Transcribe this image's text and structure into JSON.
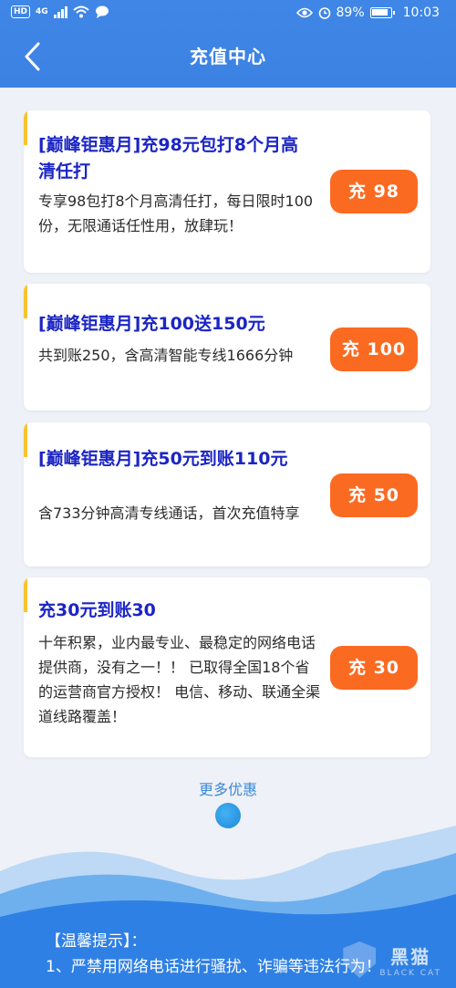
{
  "status_bar": {
    "network": "4G",
    "battery_percent": "89%",
    "time": "10:03"
  },
  "header": {
    "title": "充值中心"
  },
  "offers": [
    {
      "title": "[巅峰钜惠月]充98元包打8个月高清任打",
      "description": "专享98包打8个月高清任打，每日限时100份，无限通话任性用，放肆玩！",
      "button_label": "充 98"
    },
    {
      "title": "[巅峰钜惠月]充100送150元",
      "description": "共到账250，含高清智能专线1666分钟",
      "button_label": "充 100"
    },
    {
      "title": "[巅峰钜惠月]充50元到账110元",
      "description": "含733分钟高清专线通话，首次充值特享",
      "button_label": "充 50"
    },
    {
      "title": "充30元到账30",
      "description": "十年积累，业内最专业、最稳定的网络电话提供商，没有之一！！ 已取得全国18个省的运营商官方授权！ 电信、移动、联通全渠道线路覆盖！",
      "button_label": "充 30"
    }
  ],
  "more_link": "更多优惠",
  "tips": {
    "heading": "【温馨提示】：",
    "line1": "1、严禁用网络电话进行骚扰、诈骗等违法行为！"
  },
  "watermark": {
    "cn": "黑猫",
    "en": "BLACK CAT"
  },
  "colors": {
    "header_bg": "#3f86e6",
    "title_blue": "#1b25c4",
    "button_orange": "#fb6a21",
    "accent_yellow": "#f7c431",
    "page_bg": "#eef1f7"
  }
}
